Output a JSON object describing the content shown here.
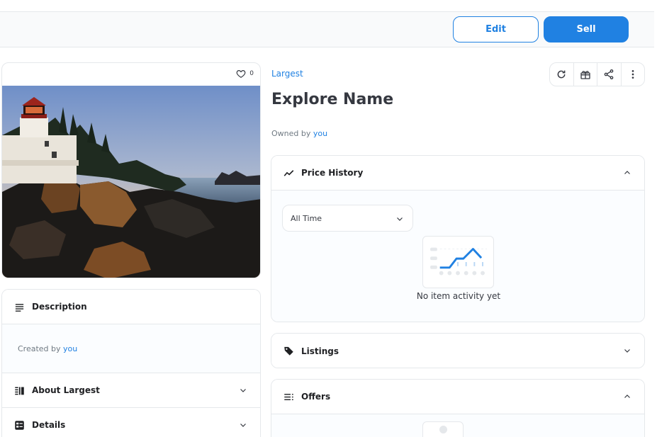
{
  "toolbar": {
    "edit_label": "Edit",
    "sell_label": "Sell"
  },
  "media": {
    "favorite_count": "0"
  },
  "item": {
    "collection": "Largest",
    "title": "Explore Name",
    "owned_by_prefix": "Owned by",
    "owner": "you"
  },
  "icon_bar": [
    "refresh-icon",
    "gift-icon",
    "share-icon",
    "more-icon"
  ],
  "description": {
    "title": "Description",
    "created_by_prefix": "Created by",
    "creator": "you"
  },
  "about": {
    "title": "About Largest"
  },
  "details": {
    "title": "Details"
  },
  "price_history": {
    "title": "Price History",
    "filter_value": "All Time",
    "empty_text": "No item activity yet"
  },
  "listings": {
    "title": "Listings"
  },
  "offers": {
    "title": "Offers"
  },
  "colors": {
    "accent": "#2081e2",
    "border": "#e5e8eb",
    "text": "#353840",
    "muted": "#707a83"
  }
}
